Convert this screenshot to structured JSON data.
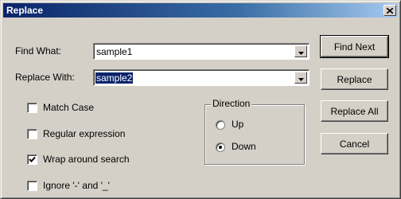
{
  "window": {
    "title": "Replace"
  },
  "find": {
    "label": "Find What:",
    "value": "sample1"
  },
  "replace": {
    "label": "Replace With:",
    "value": "sample2"
  },
  "options": [
    {
      "label": "Match Case",
      "checked": false
    },
    {
      "label": "Regular expression",
      "checked": false
    },
    {
      "label": "Wrap around search",
      "checked": true
    },
    {
      "label": "Ignore '-' and '_'",
      "checked": false
    }
  ],
  "direction": {
    "label": "Direction",
    "up": {
      "label": "Up",
      "selected": false
    },
    "down": {
      "label": "Down",
      "selected": true
    }
  },
  "buttons": {
    "find_next": "Find Next",
    "replace": "Replace",
    "replace_all": "Replace All",
    "cancel": "Cancel"
  },
  "icons": {
    "close": "close-icon",
    "dropdown": "chevron-down-icon",
    "check": "checkmark-icon"
  }
}
